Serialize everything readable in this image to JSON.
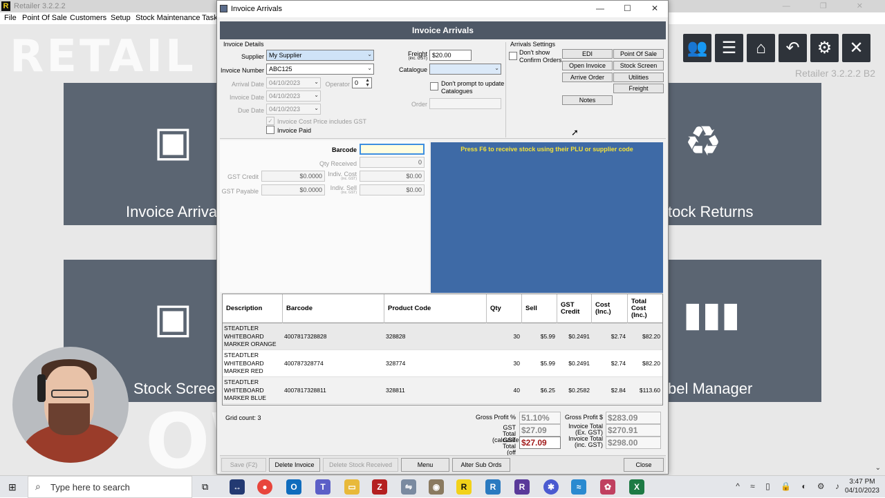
{
  "background_app": {
    "title": "Retailer 3.2.2.2",
    "menu": [
      "File",
      "Point Of Sale",
      "Customers",
      "Setup",
      "Stock Maintenance",
      "Task"
    ],
    "wordmark": "RETAIL",
    "bottom_wordmark": "OW",
    "version": "Retailer 3.2.2.2 B2",
    "tiles": {
      "invoice_arrivals": "Invoice Arriva",
      "stock_returns": "tock Returns",
      "stock_screen": "Stock Screer",
      "label_manager": "bel Manager"
    },
    "toolbar_icons": [
      "users-icon",
      "messages-icon",
      "home-icon",
      "back-icon",
      "settings-icon",
      "close-icon"
    ]
  },
  "dialog": {
    "window_title": "Invoice Arrivals",
    "header": "Invoice Arrivals",
    "invoice_details": {
      "group_label": "Invoice Details",
      "supplier_label": "Supplier",
      "supplier_value": "My Supplier",
      "invoice_number_label": "Invoice Number",
      "invoice_number_value": "ABC125",
      "arrival_date_label": "Arrival Date",
      "arrival_date_value": "04/10/2023",
      "operator_label": "Operator",
      "operator_value": "0",
      "invoice_date_label": "Invoice Date",
      "invoice_date_value": "04/10/2023",
      "due_date_label": "Due Date",
      "due_date_value": "04/10/2023",
      "cost_includes_gst_label": "Invoice Cost Price includes GST",
      "invoice_paid_label": "Invoice Paid",
      "freight_label": "Freight",
      "freight_sub": "(inc. GST)",
      "freight_value": "$20.00",
      "catalogue_label": "Catalogue",
      "catalogue_value": "",
      "dont_prompt_label": "Don't prompt to update Catalogues",
      "order_label": "Order",
      "order_value": ""
    },
    "arrivals_settings": {
      "group_label": "Arrivals Settings",
      "dont_show_label": "Don't show Confirm Orders",
      "buttons": {
        "edi": "EDI",
        "point_of_sale": "Point Of Sale",
        "open_invoice": "Open Invoice",
        "stock_screen": "Stock Screen",
        "arrive_order": "Arrive Order",
        "utilities": "Utilities",
        "freight": "Freight",
        "notes": "Notes"
      }
    },
    "entry": {
      "barcode_label": "Barcode",
      "barcode_value": "",
      "qty_received_label": "Qty Received",
      "qty_received_value": "0",
      "gst_credit_label": "GST Credit",
      "gst_credit_value": "$0.0000",
      "indiv_cost_label": "Indiv. Cost",
      "indiv_cost_sub": "(inc. GST)",
      "indiv_cost_value": "$0.00",
      "gst_payable_label": "GST Payable",
      "gst_payable_value": "$0.0000",
      "indiv_sell_label": "Indiv. Sell",
      "indiv_sell_sub": "(inc. GST)",
      "indiv_sell_value": "$0.00"
    },
    "f6_hint": "Press F6 to receive stock using their PLU or supplier code",
    "grid": {
      "headers": {
        "description": "Description",
        "barcode": "Barcode",
        "product_code": "Product Code",
        "qty": "Qty",
        "sell": "Sell",
        "gst_credit": "GST Credit",
        "cost": "Cost (Inc.)",
        "total_cost": "Total Cost (Inc.)"
      },
      "rows": [
        {
          "description": "STEADTLER WHITEBOARD MARKER ORANGE",
          "barcode": "4007817328828",
          "product_code": "328828",
          "qty": "30",
          "sell": "$5.99",
          "gst_credit": "$0.2491",
          "cost": "$2.74",
          "total": "$82.20"
        },
        {
          "description": "STEADTLER WHITEBOARD MARKER RED",
          "barcode": "400787328774",
          "product_code": "328774",
          "qty": "30",
          "sell": "$5.99",
          "gst_credit": "$0.2491",
          "cost": "$2.74",
          "total": "$82.20"
        },
        {
          "description": "STEADTLER WHITEBOARD MARKER BLUE",
          "barcode": "4007817328811",
          "product_code": "328811",
          "qty": "40",
          "sell": "$6.25",
          "gst_credit": "$0.2582",
          "cost": "$2.84",
          "total": "$113.60"
        }
      ],
      "count_text": "Grid count: 3"
    },
    "totals": {
      "gross_profit_pct_label": "Gross Profit %",
      "gross_profit_pct_value": "51.10%",
      "gross_profit_label": "Gross Profit $",
      "gross_profit_value": "$283.09",
      "gst_total_calc_label": "GST Total (calculated)",
      "gst_total_calc_value": "$27.09",
      "invoice_total_ex_label": "Invoice Total (Ex. GST)",
      "invoice_total_ex_value": "$270.91",
      "gst_total_off_label": "GST Total (off invoice)",
      "gst_total_off_value": "$27.09",
      "invoice_total_inc_label": "Invoice Total (inc. GST)",
      "invoice_total_inc_value": "$298.00"
    },
    "footer_buttons": {
      "save": "Save (F2)",
      "delete_invoice": "Delete Invoice",
      "delete_stock_received": "Delete Stock Received",
      "menu": "Menu",
      "alter_sub_ords": "Alter Sub Ords",
      "close": "Close"
    }
  },
  "taskbar": {
    "search_placeholder": "Type here to search",
    "time": "3:47 PM",
    "date": "04/10/2023"
  },
  "colors": {
    "header": "#4e5866",
    "f6_panel": "#3e6aa6",
    "f6_text": "#f5e23a",
    "tile": "#5b6572",
    "total_red": "#a11a1a"
  }
}
